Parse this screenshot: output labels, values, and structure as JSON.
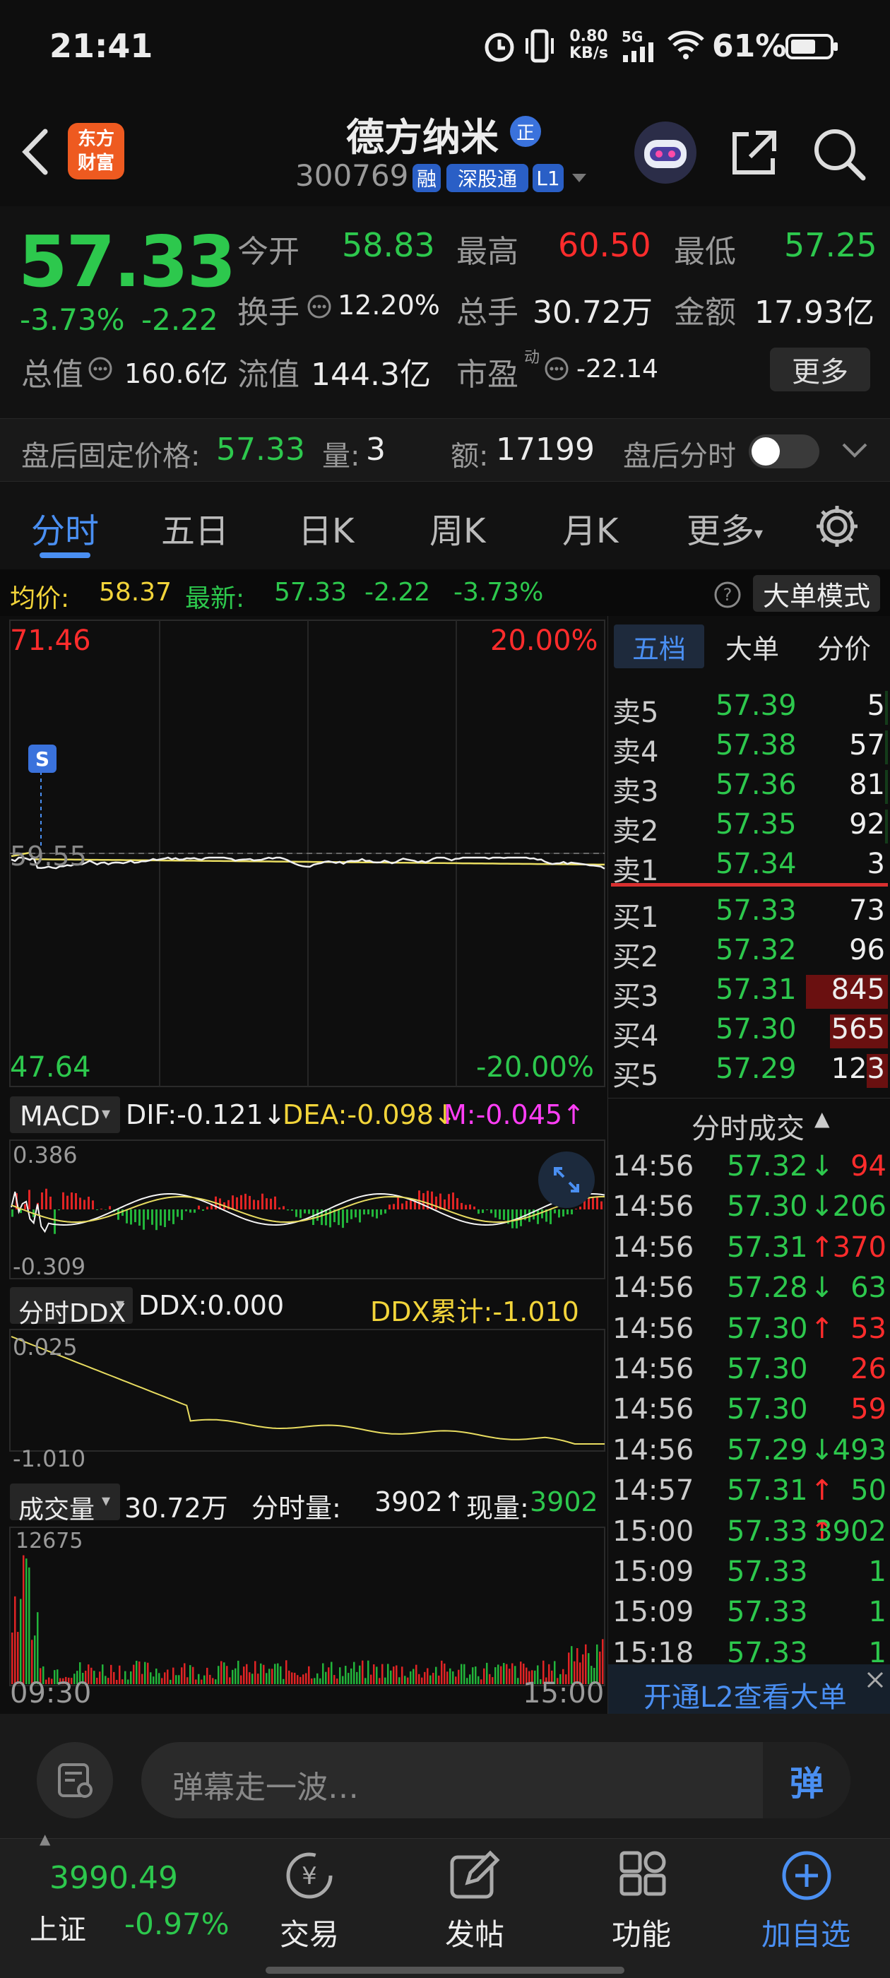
{
  "status": {
    "time": "21:41",
    "speed_top": "0.80",
    "speed_unit": "KB/s",
    "net": "5G",
    "battery": "61%"
  },
  "header": {
    "logo_line1": "东方",
    "logo_line2": "财富",
    "stock_name": "德方纳米",
    "name_badge": "正",
    "code": "300769",
    "tags": [
      "融",
      "深股通",
      "L1"
    ]
  },
  "quote": {
    "price": "57.33",
    "change_pct": "-3.73%",
    "change": "-2.22",
    "open_label": "今开",
    "open": "58.83",
    "high_label": "最高",
    "high": "60.50",
    "low_label": "最低",
    "low": "57.25",
    "turnover_label": "换手",
    "turnover": "12.20%",
    "volume_label": "总手",
    "volume": "30.72万",
    "amount_label": "金额",
    "amount": "17.93亿",
    "mktcap_label": "总值",
    "mktcap": "160.6亿",
    "float_label": "流值",
    "float": "144.3亿",
    "pe_label": "市盈",
    "pe_sup": "动",
    "pe": "-22.14",
    "more": "更多"
  },
  "after_hours": {
    "label": "盘后固定价格:",
    "price": "57.33",
    "vol_label": "量:",
    "vol": "3",
    "amt_label": "额:",
    "amt": "17199",
    "toggle_label": "盘后分时",
    "toggle_on": false
  },
  "tabs": [
    "分时",
    "五日",
    "日K",
    "周K",
    "月K",
    "更多"
  ],
  "info": {
    "avg_label": "均价:",
    "avg": "58.37",
    "latest_label": "最新:",
    "latest": "57.33",
    "chg": "-2.22",
    "pct": "-3.73%",
    "mode": "大单模式"
  },
  "chart": {
    "y_top": "71.46",
    "pct_top": "20.00%",
    "y_bottom": "47.64",
    "pct_bottom": "-20.00%",
    "mid_label": "59.55",
    "s_marker": "S",
    "time_start": "09:30",
    "time_end": "15:00"
  },
  "macd": {
    "name": "MACD",
    "dif": "DIF:-0.121↓",
    "dea": "DEA:-0.098↓",
    "m": "M:-0.045↑",
    "top": "0.386",
    "bottom": "-0.309"
  },
  "ddx": {
    "name": "分时DDX",
    "ddx": "DDX:0.000",
    "cum": "DDX累计:-1.010",
    "top": "0.025",
    "bottom": "-1.010"
  },
  "vol": {
    "name": "成交量",
    "total": "30.72万",
    "split_label": "分时量:",
    "split": "3902↑",
    "now_label": "现量:",
    "now": "3902",
    "top": "12675"
  },
  "order_tabs": [
    "五档",
    "大单",
    "分价"
  ],
  "asks": [
    {
      "label": "卖5",
      "price": "57.39",
      "qty": "5"
    },
    {
      "label": "卖4",
      "price": "57.38",
      "qty": "57"
    },
    {
      "label": "卖3",
      "price": "57.36",
      "qty": "81"
    },
    {
      "label": "卖2",
      "price": "57.35",
      "qty": "92"
    },
    {
      "label": "卖1",
      "price": "57.34",
      "qty": "3"
    }
  ],
  "bids": [
    {
      "label": "买1",
      "price": "57.33",
      "qty": "73"
    },
    {
      "label": "买2",
      "price": "57.32",
      "qty": "96"
    },
    {
      "label": "买3",
      "price": "57.31",
      "qty": "845"
    },
    {
      "label": "买4",
      "price": "57.30",
      "qty": "565"
    },
    {
      "label": "买5",
      "price": "57.29",
      "qty": "123"
    }
  ],
  "trades_title": "分时成交",
  "trades": [
    {
      "t": "14:56",
      "p": "57.32",
      "d": "↓",
      "q": "94",
      "c": "r"
    },
    {
      "t": "14:56",
      "p": "57.30",
      "d": "↓",
      "q": "206",
      "c": "g"
    },
    {
      "t": "14:56",
      "p": "57.31",
      "d": "↑",
      "q": "370",
      "c": "r"
    },
    {
      "t": "14:56",
      "p": "57.28",
      "d": "↓",
      "q": "63",
      "c": "g"
    },
    {
      "t": "14:56",
      "p": "57.30",
      "d": "↑",
      "q": "53",
      "c": "r"
    },
    {
      "t": "14:56",
      "p": "57.30",
      "d": "",
      "q": "26",
      "c": "r"
    },
    {
      "t": "14:56",
      "p": "57.30",
      "d": "",
      "q": "59",
      "c": "r"
    },
    {
      "t": "14:56",
      "p": "57.29",
      "d": "↓",
      "q": "493",
      "c": "g"
    },
    {
      "t": "14:57",
      "p": "57.31",
      "d": "↑",
      "q": "50",
      "c": "g"
    },
    {
      "t": "15:00",
      "p": "57.33",
      "d": "↑",
      "q": "3902",
      "c": "g"
    },
    {
      "t": "15:09",
      "p": "57.33",
      "d": "",
      "q": "1",
      "c": "g"
    },
    {
      "t": "15:09",
      "p": "57.33",
      "d": "",
      "q": "1",
      "c": "g"
    },
    {
      "t": "15:18",
      "p": "57.33",
      "d": "",
      "q": "1",
      "c": "g"
    }
  ],
  "l2_banner": "开通L2查看大单",
  "danmaku": {
    "placeholder": "弹幕走一波…",
    "btn": "弹"
  },
  "bottom_nav": {
    "index_value": "3990.49",
    "index_name": "上证",
    "index_pct": "-0.97%",
    "items": [
      "交易",
      "发帖",
      "功能",
      "加自选"
    ]
  }
}
